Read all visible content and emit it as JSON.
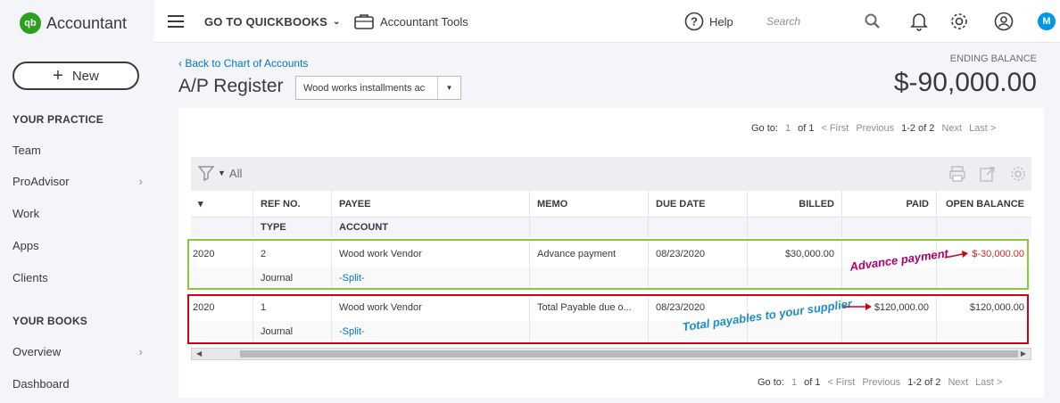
{
  "brand": {
    "logo": "qb",
    "name": "Accountant"
  },
  "sidebar": {
    "new_label": "New",
    "sections": [
      "YOUR PRACTICE",
      "YOUR BOOKS"
    ],
    "items": [
      {
        "label": "Team",
        "chevron": false
      },
      {
        "label": "ProAdvisor",
        "chevron": true
      },
      {
        "label": "Work",
        "chevron": false
      },
      {
        "label": "Apps",
        "chevron": false
      },
      {
        "label": "Clients",
        "chevron": false
      },
      {
        "label": "Overview",
        "chevron": true
      },
      {
        "label": "Dashboard",
        "chevron": false
      }
    ]
  },
  "topbar": {
    "goto_label": "GO TO QUICKBOOKS",
    "tools_label": "Accountant Tools",
    "help_label": "Help",
    "search_placeholder": "Search",
    "avatar_initial": "M"
  },
  "main": {
    "back_link": "Back to Chart of Accounts",
    "title": "A/P Register",
    "account_select": "Wood works installments ac",
    "ending_balance_label": "ENDING BALANCE",
    "ending_balance": "$-90,000.00"
  },
  "pager": {
    "goto_label": "Go to:",
    "page": "1",
    "of": "of 1",
    "first": "< First",
    "previous": "Previous",
    "range": "1-2 of 2",
    "next": "Next",
    "last": "Last >"
  },
  "filter": {
    "label": "All"
  },
  "table": {
    "headers_top": [
      "▾",
      "REF NO.",
      "PAYEE",
      "MEMO",
      "DUE DATE",
      "BILLED",
      "PAID",
      "OPEN BALANCE"
    ],
    "headers_bottom": [
      "",
      "TYPE",
      "ACCOUNT",
      "",
      "",
      "",
      "",
      ""
    ],
    "rows": [
      {
        "date": "2020",
        "ref": "2",
        "payee": "Wood work Vendor",
        "memo": "Advance payment",
        "due": "08/23/2020",
        "billed": "$30,000.00",
        "paid": "",
        "open": "$-30,000.00",
        "type": "Journal",
        "account": "-Split-"
      },
      {
        "date": "2020",
        "ref": "1",
        "payee": "Wood work Vendor",
        "memo": "Total Payable due o...",
        "due": "08/23/2020",
        "billed": "",
        "paid": "$120,000.00",
        "open": "$120,000.00",
        "type": "Journal",
        "account": "-Split-"
      }
    ]
  },
  "annotations": {
    "advance": "Advance payment",
    "total": "Total payables to your supplier"
  },
  "colors": {
    "accent": "#0077c5",
    "brand": "#2ca01c",
    "highlight_green": "#8cc63f",
    "highlight_red": "#d0021b"
  }
}
